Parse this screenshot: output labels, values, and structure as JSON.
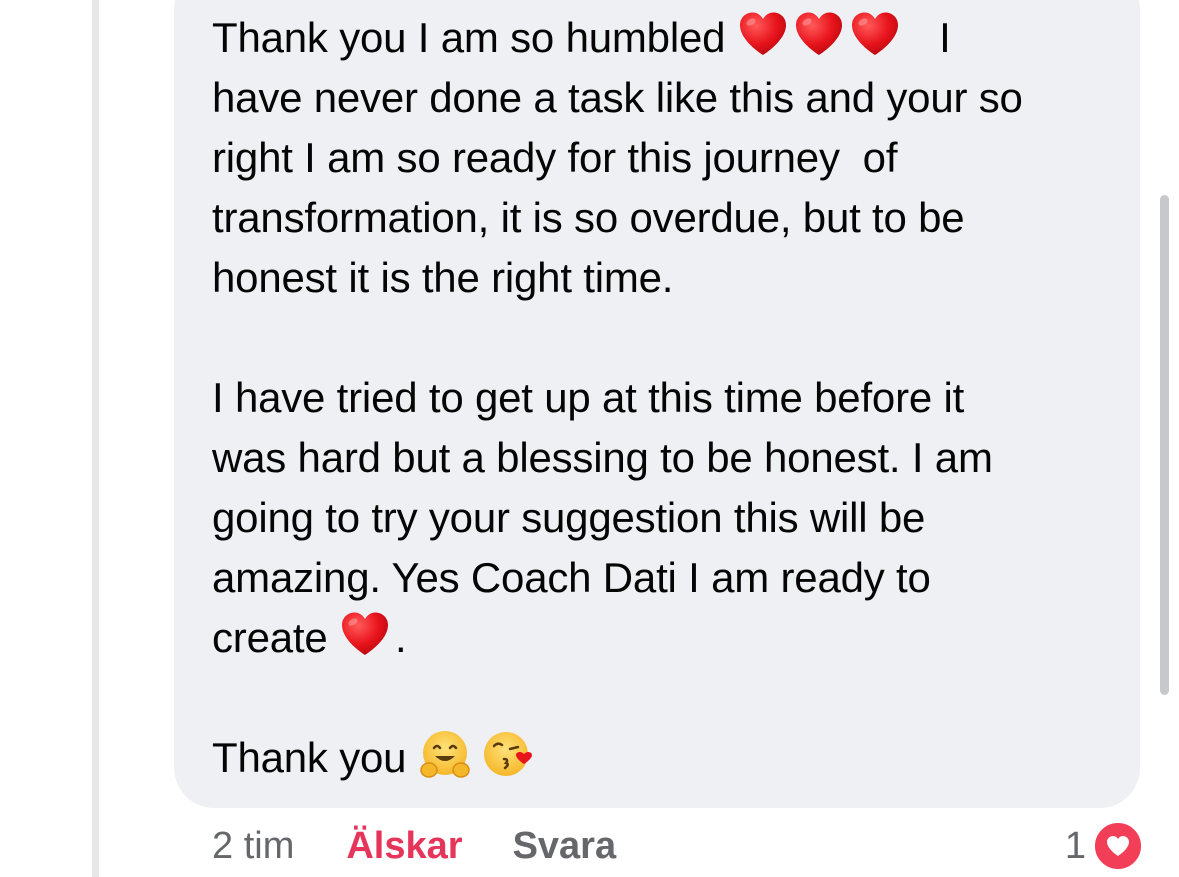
{
  "comment": {
    "paragraphs": [
      {
        "lines": [
          {
            "parts": [
              {
                "t": "text",
                "v": "Thank you I am so humbled "
              },
              {
                "t": "emoji",
                "v": "red-heart"
              },
              {
                "t": "emoji",
                "v": "red-heart"
              },
              {
                "t": "emoji",
                "v": "red-heart"
              },
              {
                "t": "text",
                "v": "   I"
              }
            ]
          },
          {
            "parts": [
              {
                "t": "text",
                "v": "have never done a task like this and your so"
              }
            ]
          },
          {
            "parts": [
              {
                "t": "text",
                "v": "right I am so ready for this journey  of"
              }
            ]
          },
          {
            "parts": [
              {
                "t": "text",
                "v": "transformation, it is so overdue, but to be"
              }
            ]
          },
          {
            "parts": [
              {
                "t": "text",
                "v": "honest it is the right time."
              }
            ]
          }
        ]
      },
      {
        "lines": [
          {
            "parts": [
              {
                "t": "text",
                "v": "I have tried to get up at this time before it"
              }
            ]
          },
          {
            "parts": [
              {
                "t": "text",
                "v": "was hard but a blessing to be honest. I am"
              }
            ]
          },
          {
            "parts": [
              {
                "t": "text",
                "v": "going to try your suggestion this will be"
              }
            ]
          },
          {
            "parts": [
              {
                "t": "text",
                "v": "amazing. Yes Coach Dati I am ready to"
              }
            ]
          },
          {
            "parts": [
              {
                "t": "text",
                "v": "create "
              },
              {
                "t": "emoji",
                "v": "red-heart"
              },
              {
                "t": "text",
                "v": "."
              }
            ]
          }
        ]
      },
      {
        "lines": [
          {
            "parts": [
              {
                "t": "text",
                "v": "Thank you "
              },
              {
                "t": "emoji",
                "v": "hugging-face"
              },
              {
                "t": "emoji",
                "v": "face-blowing-kiss"
              }
            ]
          }
        ]
      }
    ]
  },
  "actions": {
    "time": "2 tim",
    "love_label": "Älskar",
    "reply_label": "Svara"
  },
  "reaction": {
    "count": "1",
    "icon": "heart-reaction-icon",
    "color": "#f33e58"
  },
  "colors": {
    "bubble": "#eff0f4",
    "text": "#050505",
    "meta": "#65676b",
    "love": "#e5355a"
  }
}
